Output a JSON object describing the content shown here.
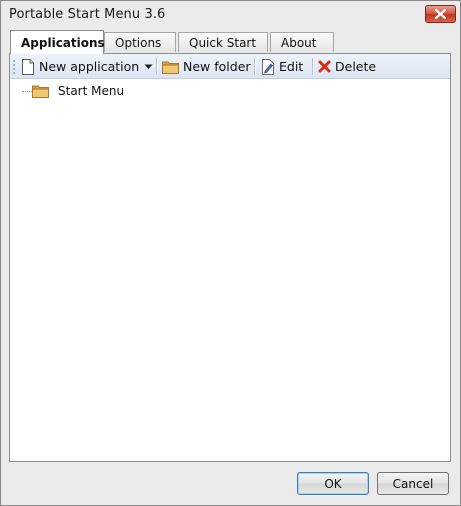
{
  "window": {
    "title": "Portable Start Menu 3.6"
  },
  "tabs": [
    {
      "label": "Applications",
      "active": true
    },
    {
      "label": "Options",
      "active": false
    },
    {
      "label": "Quick Start",
      "active": false
    },
    {
      "label": "About",
      "active": false
    }
  ],
  "toolbar": {
    "new_application": "New application",
    "new_folder": "New folder",
    "edit": "Edit",
    "delete": "Delete"
  },
  "tree": {
    "root_label": "Start Menu"
  },
  "buttons": {
    "ok": "OK",
    "cancel": "Cancel"
  },
  "colors": {
    "close_button": "#c2321d",
    "toolbar_gradient_top": "#eef3f9",
    "folder": "#e6b85c",
    "delete_icon": "#d92b1a"
  },
  "icons": {
    "close": "close-icon",
    "new_application": "document-icon",
    "dropdown": "chevron-down-icon",
    "new_folder": "folder-icon",
    "edit": "pencil-icon",
    "delete": "red-x-icon",
    "tree_root": "folder-icon"
  }
}
